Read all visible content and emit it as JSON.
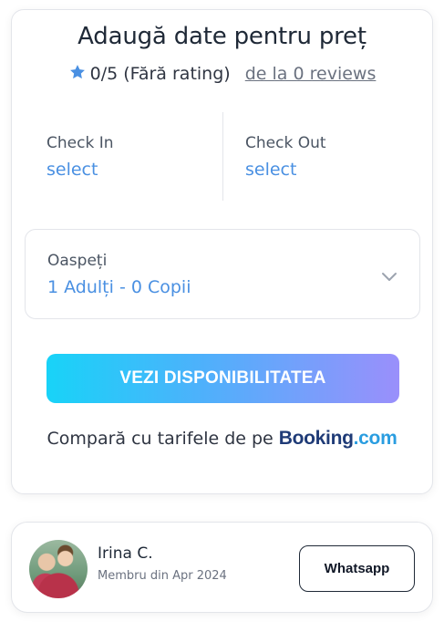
{
  "booking_widget": {
    "title": "Adaugă date pentru preț",
    "rating": {
      "score": "0/5",
      "label": "(Fără rating)",
      "reviews_link": "de la 0 reviews",
      "star_color": "#4a90e2"
    },
    "check_in": {
      "label": "Check In",
      "value": "select"
    },
    "check_out": {
      "label": "Check Out",
      "value": "select"
    },
    "guests": {
      "label": "Oaspeți",
      "value": "1 Adulți - 0 Copii"
    },
    "cta_label": "VEZI DISPONIBILITATEA",
    "compare": {
      "text": "Compară cu tarifele de pe",
      "logo_main": "Booking",
      "logo_suffix": ".com"
    }
  },
  "host": {
    "name": "Irina C.",
    "member_since": "Membru din Apr 2024",
    "contact_button": "Whatsapp"
  },
  "colors": {
    "accent": "#4a90e2",
    "cta_gradient_start": "#18d3f8",
    "cta_gradient_end": "#9a8ffb",
    "booking_dark": "#1f3b77",
    "booking_light": "#2a9de0"
  }
}
